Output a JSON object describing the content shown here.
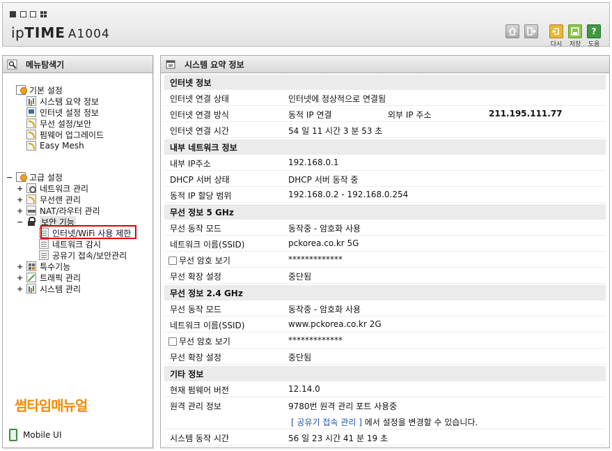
{
  "header": {
    "brand_prefix": "ip",
    "brand_bold": "TIME",
    "model": "A1004",
    "buttons": {
      "home_icon": "home-icon",
      "logout_icon": "logout-icon",
      "reload_label": "다시",
      "save_label": "저장",
      "help_label": "도움"
    },
    "colors": {
      "reload": "#e7b83a",
      "save": "#8cc44a",
      "help": "#3f9a3f"
    }
  },
  "left": {
    "title": "메뉴탐색기",
    "basic": {
      "label": "기본 설정",
      "items": [
        "시스템 요약 정보",
        "인터넷 설정 정보",
        "무선 설정/보안",
        "펌웨어 업그레이드",
        "Easy Mesh"
      ]
    },
    "advanced": {
      "toggle": "−",
      "label": "고급 설정",
      "items": [
        {
          "toggle": "+",
          "label": "네트워크 관리"
        },
        {
          "toggle": "+",
          "label": "무선랜 관리"
        },
        {
          "toggle": "+",
          "label": "NAT/라우터 관리"
        },
        {
          "toggle": "−",
          "label": "보안 기능"
        },
        {
          "toggle": "+",
          "label": "특수기능"
        },
        {
          "toggle": "+",
          "label": "트래픽 관리"
        },
        {
          "toggle": "+",
          "label": "시스템 관리"
        }
      ],
      "security_items": [
        "인터넷/WiFi 사용 제한",
        "네트워크 감시",
        "공유기 접속/보안관리"
      ]
    },
    "watermark": "썸타임매뉴얼",
    "mobile_label": "Mobile UI"
  },
  "right": {
    "title": "시스템 요약 정보",
    "internet": {
      "heading": "인터넷 정보",
      "status_label": "인터넷 연결 상태",
      "status_value": "인터넷에 정상적으로 연결됨",
      "method_label": "인터넷 연결 방식",
      "method_value": "동적 IP 연결",
      "ext_ip_label": "외부 IP 주소",
      "ext_ip_value": "211.195.111.77",
      "time_label": "인터넷 연결 시간",
      "time_value": "54 일 11 시간 3 분 53 초"
    },
    "internal": {
      "heading": "내부 네트워크 정보",
      "ip_label": "내부 IP주소",
      "ip_value": "192.168.0.1",
      "dhcp_label": "DHCP 서버 상태",
      "dhcp_value": "DHCP 서버 동작 중",
      "range_label": "동적 IP 할당 범위",
      "range_value": "192.168.0.2 -  192.168.0.254"
    },
    "wifi5": {
      "heading": "무선 정보 5 GHz",
      "mode_label": "무선 동작 모드",
      "mode_value": "동작중 - 암호화 사용",
      "ssid_label": "네트워크 이름(SSID)",
      "ssid_value": "pckorea.co.kr 5G",
      "pw_label": "무선 암호 보기",
      "pw_value": "*************",
      "ext_label": "무선 확장 설정",
      "ext_value": "중단됨"
    },
    "wifi24": {
      "heading": "무선 정보 2.4 GHz",
      "mode_label": "무선 동작 모드",
      "mode_value": "동작중 - 암호화 사용",
      "ssid_label": "네트워크 이름(SSID)",
      "ssid_value": "www.pckorea.co.kr 2G",
      "pw_label": "무선 암호 보기",
      "pw_value": "*************",
      "ext_label": "무선 확장 설정",
      "ext_value": "중단됨"
    },
    "etc": {
      "heading": "기타 정보",
      "fw_label": "현재 펌웨어 버전",
      "fw_value": "12.14.0",
      "remote_label": "원격 관리 정보",
      "remote_value": "9780번 원격 관리 포트 사용중",
      "link_text": "[ 공유기 접속 관리 ]",
      "link_suffix": " 에서 설정을 변경할 수 있습니다.",
      "uptime_label": "시스템 동작 시간",
      "uptime_value": "56 일 23 시간 41 분 19 초"
    }
  }
}
